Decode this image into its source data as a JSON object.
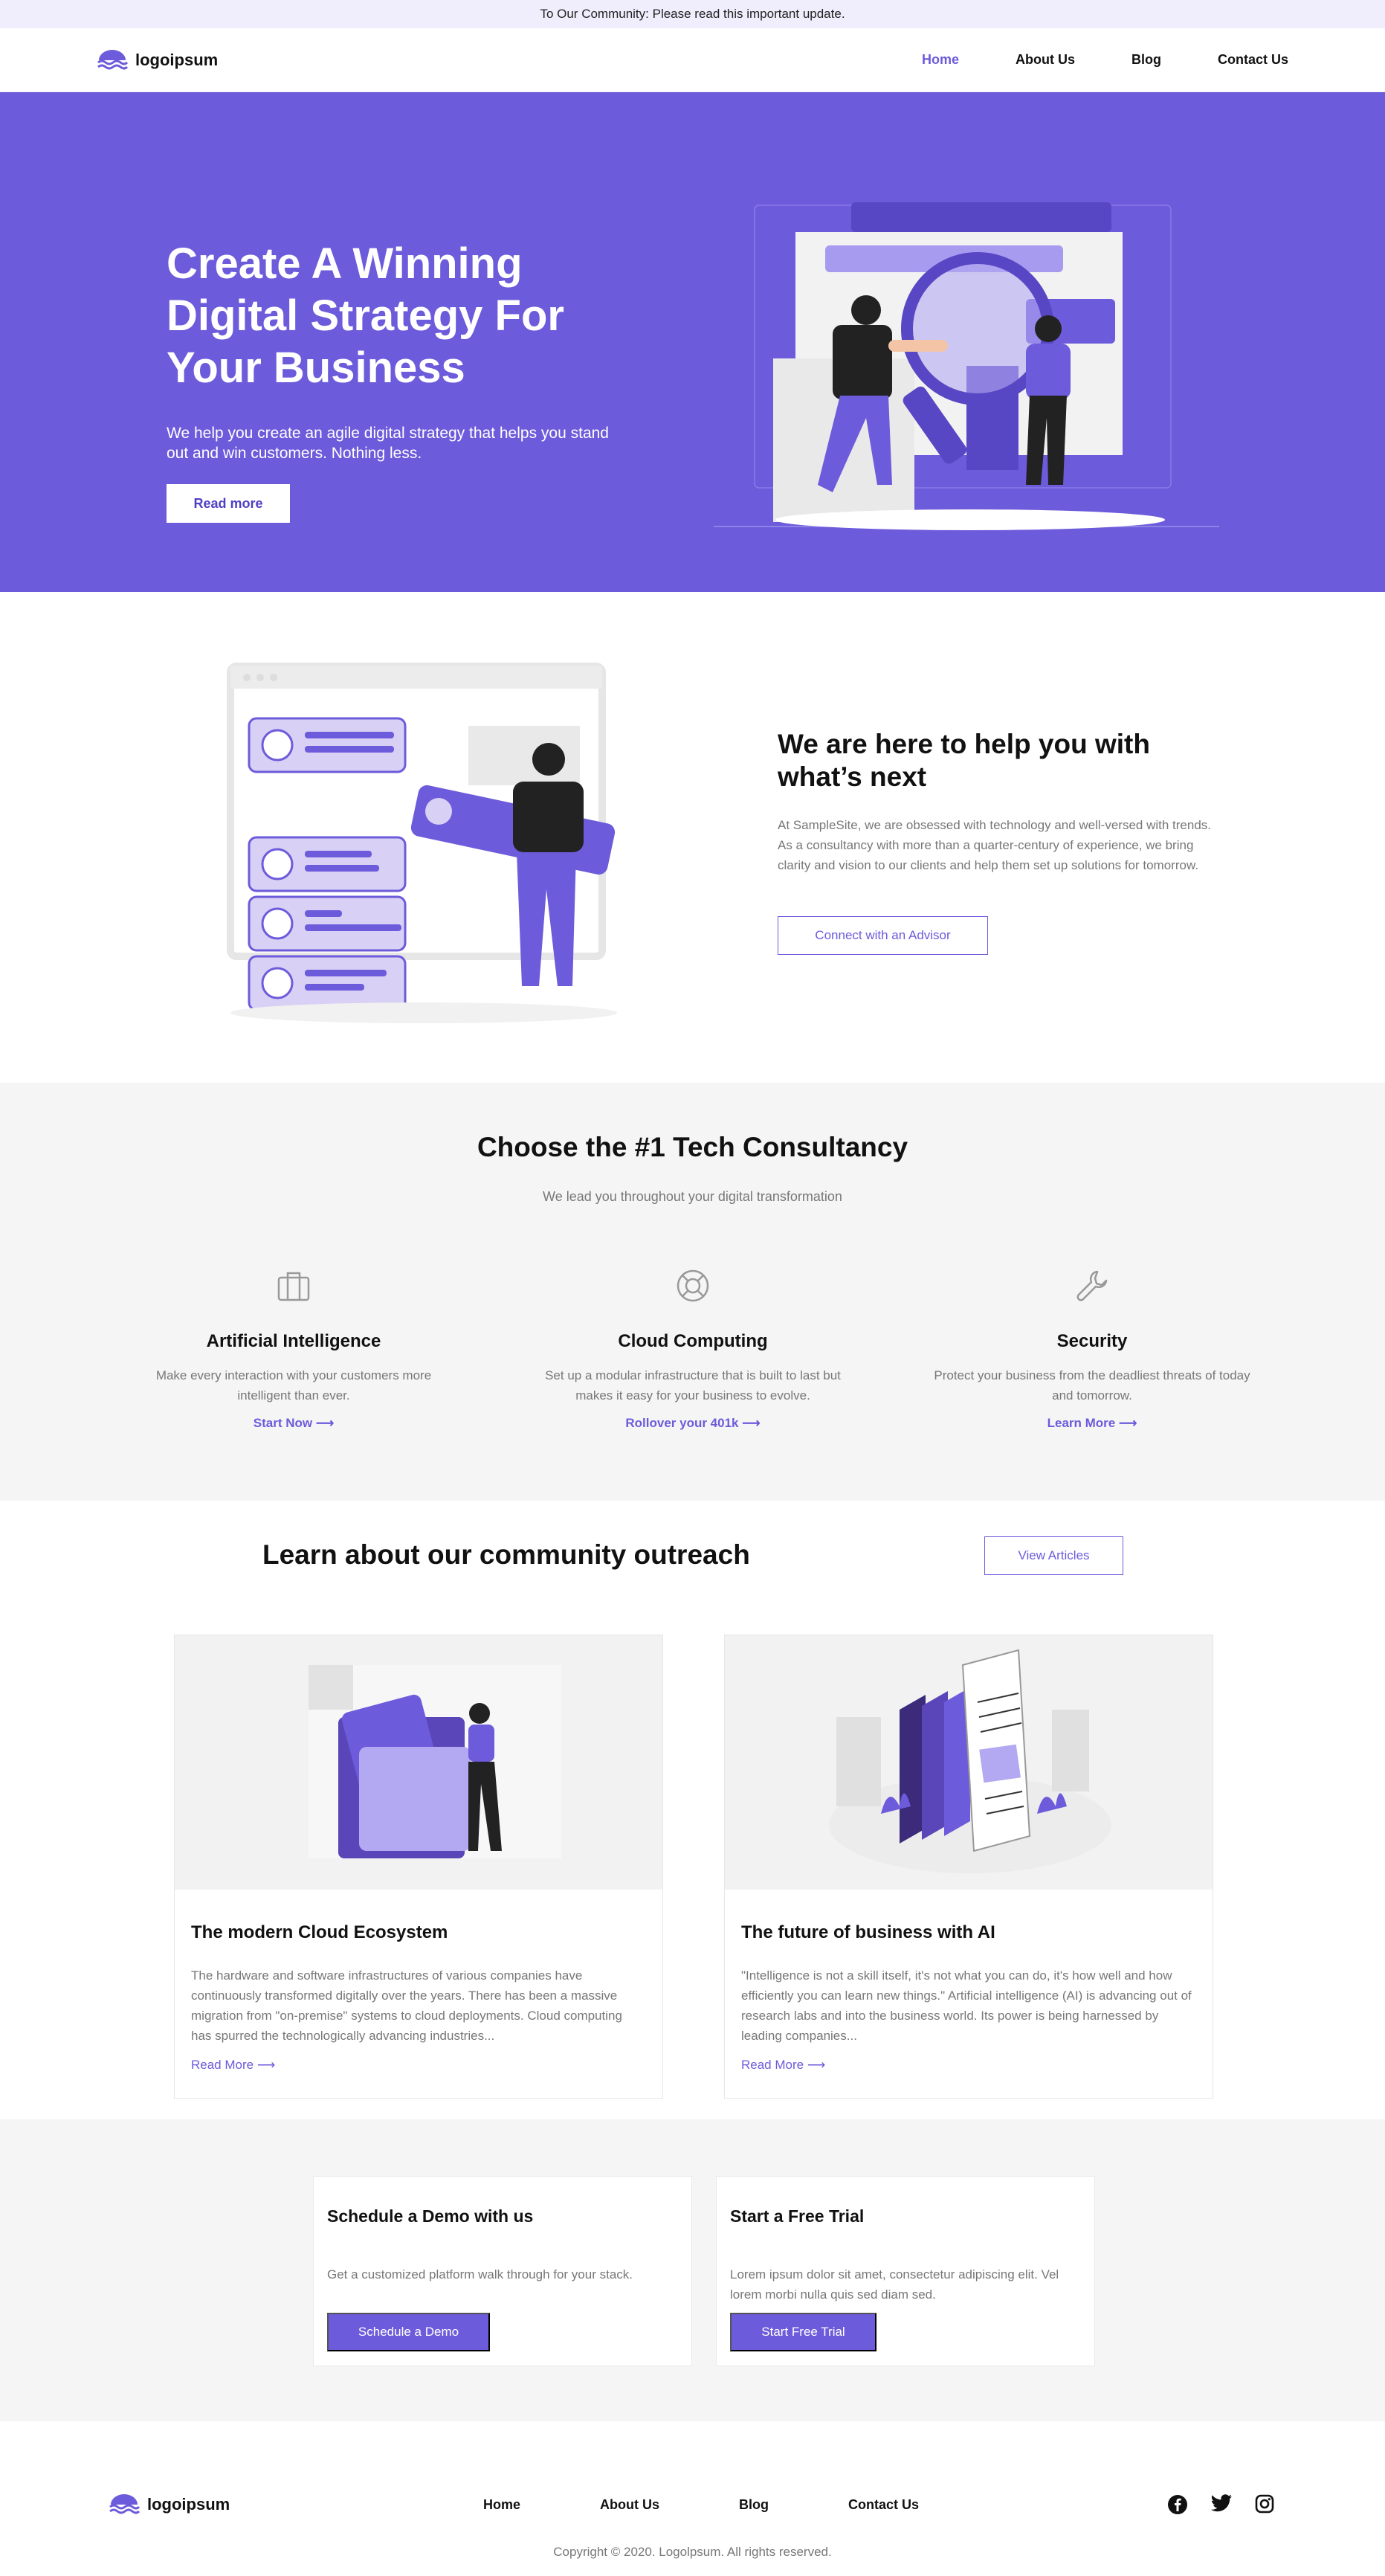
{
  "announcement": "To Our Community: Please read this important update.",
  "brand": {
    "name": "logoipsum",
    "accent": "#6c5bdb"
  },
  "nav": {
    "items": [
      {
        "label": "Home",
        "active": true
      },
      {
        "label": "About Us",
        "active": false
      },
      {
        "label": "Blog",
        "active": false
      },
      {
        "label": "Contact Us",
        "active": false
      }
    ]
  },
  "hero": {
    "title": "Create A Winning Digital Strategy For Your Business",
    "text": "We help you create an agile digital strategy that helps you stand out and win customers. Nothing less.",
    "button": "Read more"
  },
  "help": {
    "title": "We are here to help you with what’s next",
    "text": "At SampleSite, we are obsessed with technology and well-versed with trends. As a consultancy with more than a quarter-century of experience, we bring clarity and vision to our clients and help them set up solutions for tomorrow.",
    "button": "Connect with an Advisor"
  },
  "choose": {
    "title": "Choose the #1 Tech Consultancy",
    "subtitle": "We lead you throughout your digital transformation",
    "features": [
      {
        "icon": "briefcase-icon",
        "title": "Artificial Intelligence",
        "text": "Make every interaction with your customers more intelligent than ever.",
        "link": "Start Now"
      },
      {
        "icon": "lifebuoy-icon",
        "title": "Cloud Computing",
        "text": "Set up a modular infrastructure that is built to last but makes it easy for your business to evolve.",
        "link": "Rollover your 401k"
      },
      {
        "icon": "wrench-icon",
        "title": "Security",
        "text": "Protect your business from the deadliest threats of today and tomorrow.",
        "link": "Learn More"
      }
    ]
  },
  "outreach": {
    "title": "Learn about our community outreach",
    "button": "View Articles",
    "articles": [
      {
        "title": "The modern Cloud Ecosystem",
        "text": "The hardware and software infrastructures of various companies have continuously transformed digitally over the years. There has been a massive migration from \"on-premise\" systems to cloud deployments. Cloud computing has spurred the technologically advancing industries...",
        "link": "Read More"
      },
      {
        "title": "The future of business with AI",
        "text": "\"Intelligence is not a skill itself, it's not what you can do, it's how well and how efficiently you can learn new things.\" Artificial intelligence (AI) is advancing out of research labs and into the business world. Its power is being harnessed by leading companies...",
        "link": "Read More"
      }
    ]
  },
  "cta": [
    {
      "title": "Schedule a Demo with us",
      "text": "Get a customized platform walk through for your stack.",
      "button": "Schedule a Demo"
    },
    {
      "title": "Start a Free Trial",
      "text": "Lorem ipsum dolor sit amet, consectetur adipiscing elit. Vel lorem morbi nulla quis sed diam sed.",
      "button": "Start Free Trial"
    }
  ],
  "footer": {
    "links": [
      "Home",
      "About Us",
      "Blog",
      "Contact Us"
    ],
    "social": [
      "facebook-icon",
      "twitter-icon",
      "instagram-icon"
    ],
    "copyright": "Copyright © 2020. Logolpsum. All rights reserved."
  }
}
